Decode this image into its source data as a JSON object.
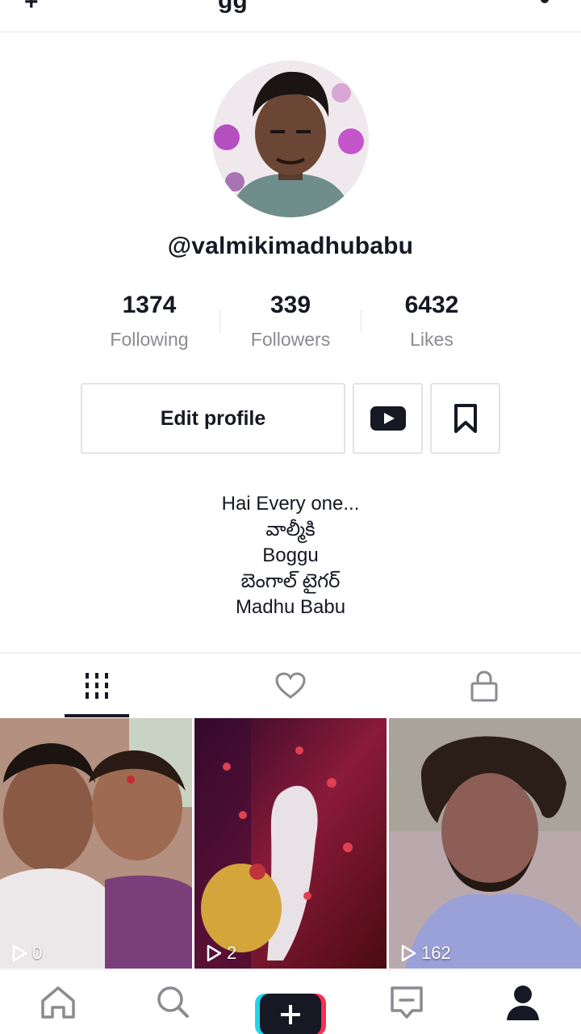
{
  "header": {
    "add_user_glyph": "+",
    "title_fragment": "gg"
  },
  "profile": {
    "username": "@valmikimadhubabu",
    "stats": [
      {
        "value": "1374",
        "label": "Following"
      },
      {
        "value": "339",
        "label": "Followers"
      },
      {
        "value": "6432",
        "label": "Likes"
      }
    ],
    "edit_button": "Edit profile",
    "bio": [
      "Hai Every one...",
      "వాల్మీకి",
      "Boggu",
      "బెంగాల్ టైగర్",
      "Madhu Babu"
    ]
  },
  "tabs": [
    {
      "icon": "grid-icon",
      "active": true
    },
    {
      "icon": "heart-icon",
      "active": false
    },
    {
      "icon": "lock-icon",
      "active": false
    }
  ],
  "videos": [
    {
      "views": "0"
    },
    {
      "views": "2"
    },
    {
      "views": "162"
    }
  ],
  "colors": {
    "text": "#161823",
    "secondary": "#8a8b91",
    "border": "#e3e3e4",
    "create_left": "#20d5ec",
    "create_right": "#fe2c55"
  }
}
